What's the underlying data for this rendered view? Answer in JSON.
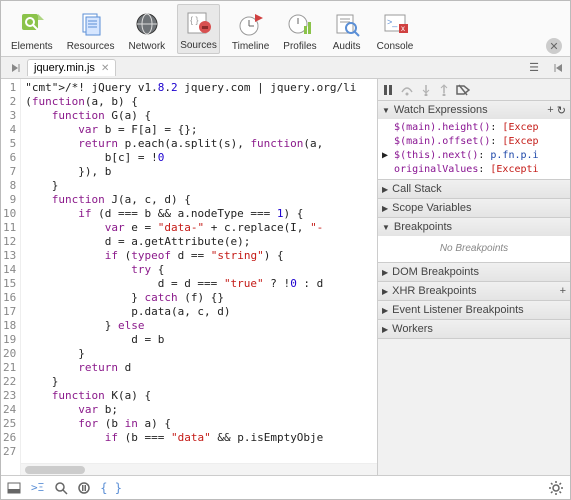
{
  "toolbar": {
    "items": [
      {
        "label": "Elements"
      },
      {
        "label": "Resources"
      },
      {
        "label": "Network"
      },
      {
        "label": "Sources"
      },
      {
        "label": "Timeline"
      },
      {
        "label": "Profiles"
      },
      {
        "label": "Audits"
      },
      {
        "label": "Console"
      }
    ]
  },
  "tab": {
    "filename": "jquery.min.js"
  },
  "code": {
    "lines": [
      "/*! jQuery v1.8.2 jquery.com | jquery.org/li",
      "(function(a, b) {",
      "    function G(a) {",
      "        var b = F[a] = {};",
      "        return p.each(a.split(s), function(a,",
      "            b[c] = !0",
      "        }), b",
      "    }",
      "    function J(a, c, d) {",
      "        if (d === b && a.nodeType === 1) {",
      "            var e = \"data-\" + c.replace(I, \"-",
      "            d = a.getAttribute(e);",
      "            if (typeof d == \"string\") {",
      "                try {",
      "                    d = d === \"true\" ? !0 : d",
      "                } catch (f) {}",
      "                p.data(a, c, d)",
      "            } else",
      "                d = b",
      "        }",
      "        return d",
      "    }",
      "    function K(a) {",
      "        var b;",
      "        for (b in a) {",
      "            if (b === \"data\" && p.isEmptyObje",
      ""
    ]
  },
  "panels": {
    "watch": {
      "title": "Watch Expressions",
      "rows": [
        {
          "k": "$(main).height()",
          "v": "[Excep"
        },
        {
          "k": "$(main).offset()",
          "v": "[Excep"
        },
        {
          "k": "$(this).next()",
          "v": "p.fn.p.i",
          "blue": true,
          "arrow": true
        },
        {
          "k": "originalValues",
          "v": "[Excepti"
        }
      ]
    },
    "callstack": {
      "title": "Call Stack"
    },
    "scope": {
      "title": "Scope Variables"
    },
    "breakpoints": {
      "title": "Breakpoints",
      "empty": "No Breakpoints"
    },
    "dom": {
      "title": "DOM Breakpoints"
    },
    "xhr": {
      "title": "XHR Breakpoints"
    },
    "event": {
      "title": "Event Listener Breakpoints"
    },
    "workers": {
      "title": "Workers"
    }
  }
}
